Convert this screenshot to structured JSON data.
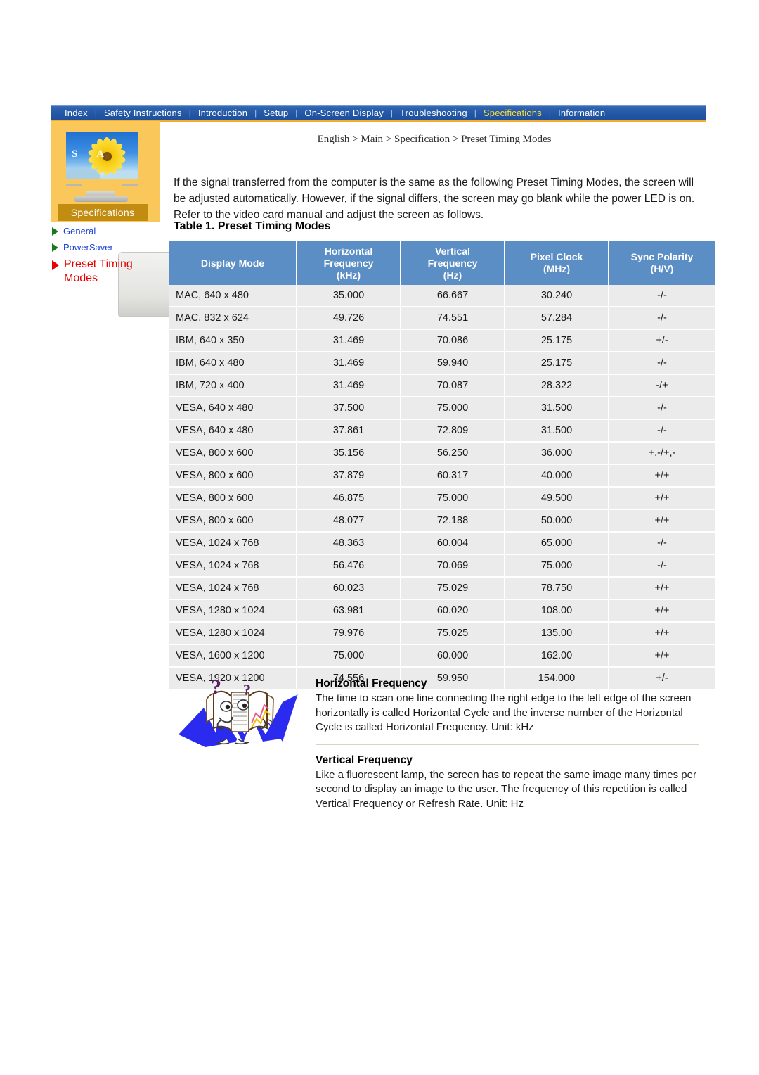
{
  "nav": {
    "items": [
      {
        "label": "Index",
        "active": false
      },
      {
        "label": "Safety Instructions",
        "active": false
      },
      {
        "label": "Introduction",
        "active": false
      },
      {
        "label": "Setup",
        "active": false
      },
      {
        "label": "On-Screen Display",
        "active": false
      },
      {
        "label": "Troubleshooting",
        "active": false
      },
      {
        "label": "Specifications",
        "active": true
      },
      {
        "label": "Information",
        "active": false
      }
    ],
    "separator": "|",
    "accent_color": "#ffdd33",
    "bar_color": "#2258a6",
    "underline_color": "#f5ab27"
  },
  "sidebar": {
    "banner_label": "Specifications",
    "screen_letters": "S A",
    "items": [
      {
        "label": "General",
        "state": "normal"
      },
      {
        "label": "PowerSaver",
        "state": "normal"
      },
      {
        "label": "Preset Timing Modes",
        "state": "current"
      }
    ],
    "link_color": "#1a3fd4",
    "current_color": "#e60000",
    "bullet_color": "#1a7a1a",
    "band_color": "#fac75b"
  },
  "content": {
    "breadcrumb": "English > Main > Specification > Preset Timing Modes",
    "intro": "If the signal transferred from the computer is the same as the following Preset Timing Modes, the screen will be adjusted automatically. However, if the signal differs, the screen may go blank while the power LED is on. Refer to the video card manual and adjust the screen as follows.",
    "table_caption": "Table 1. Preset Timing Modes"
  },
  "chart_data": {
    "type": "table",
    "title": "Table 1. Preset Timing Modes",
    "columns": [
      {
        "header": "Display Mode",
        "unit": ""
      },
      {
        "header": "Horizontal Frequency",
        "unit": "(kHz)"
      },
      {
        "header": "Vertical Frequency",
        "unit": "(Hz)"
      },
      {
        "header": "Pixel Clock",
        "unit": "(MHz)"
      },
      {
        "header": "Sync Polarity",
        "unit": "(H/V)"
      }
    ],
    "header_lines": [
      [
        "Display Mode"
      ],
      [
        "Horizontal",
        "Frequency",
        "(kHz)"
      ],
      [
        "Vertical",
        "Frequency",
        "(Hz)"
      ],
      [
        "Pixel Clock",
        "(MHz)"
      ],
      [
        "Sync Polarity",
        "(H/V)"
      ]
    ],
    "rows": [
      [
        "MAC, 640 x 480",
        "35.000",
        "66.667",
        "30.240",
        "-/-"
      ],
      [
        "MAC, 832 x 624",
        "49.726",
        "74.551",
        "57.284",
        "-/-"
      ],
      [
        "IBM, 640 x 350",
        "31.469",
        "70.086",
        "25.175",
        "+/-"
      ],
      [
        "IBM, 640 x 480",
        "31.469",
        "59.940",
        "25.175",
        "-/-"
      ],
      [
        "IBM, 720 x 400",
        "31.469",
        "70.087",
        "28.322",
        "-/+"
      ],
      [
        "VESA, 640 x 480",
        "37.500",
        "75.000",
        "31.500",
        "-/-"
      ],
      [
        "VESA, 640 x 480",
        "37.861",
        "72.809",
        "31.500",
        "-/-"
      ],
      [
        "VESA, 800 x 600",
        "35.156",
        "56.250",
        "36.000",
        "+,-/+,-"
      ],
      [
        "VESA, 800 x 600",
        "37.879",
        "60.317",
        "40.000",
        "+/+"
      ],
      [
        "VESA, 800 x 600",
        "46.875",
        "75.000",
        "49.500",
        "+/+"
      ],
      [
        "VESA, 800 x 600",
        "48.077",
        "72.188",
        "50.000",
        "+/+"
      ],
      [
        "VESA, 1024 x 768",
        "48.363",
        "60.004",
        "65.000",
        "-/-"
      ],
      [
        "VESA, 1024 x 768",
        "56.476",
        "70.069",
        "75.000",
        "-/-"
      ],
      [
        "VESA, 1024 x 768",
        "60.023",
        "75.029",
        "78.750",
        "+/+"
      ],
      [
        "VESA, 1280 x 1024",
        "63.981",
        "60.020",
        "108.00",
        "+/+"
      ],
      [
        "VESA, 1280 x 1024",
        "79.976",
        "75.025",
        "135.00",
        "+/+"
      ],
      [
        "VESA, 1600 x 1200",
        "75.000",
        "60.000",
        "162.00",
        "+/+"
      ],
      [
        "VESA, 1920 x 1200",
        "74.556",
        "59.950",
        "154.000",
        "+/-"
      ]
    ],
    "header_bg": "#5b8ec4",
    "row_bg": "#ebebeb"
  },
  "definitions": [
    {
      "title": "Horizontal Frequency",
      "text": "The time to scan one line connecting the right edge to the left edge of the screen horizontally is called Horizontal Cycle and the inverse number of the Horizontal Cycle is called Horizontal Frequency. Unit: kHz"
    },
    {
      "title": "Vertical Frequency",
      "text": "Like a fluorescent lamp, the screen has to repeat the same image many times per second to display an image to the user. The frequency of this repetition is called Vertical Frequency or Refresh Rate. Unit: Hz"
    }
  ]
}
